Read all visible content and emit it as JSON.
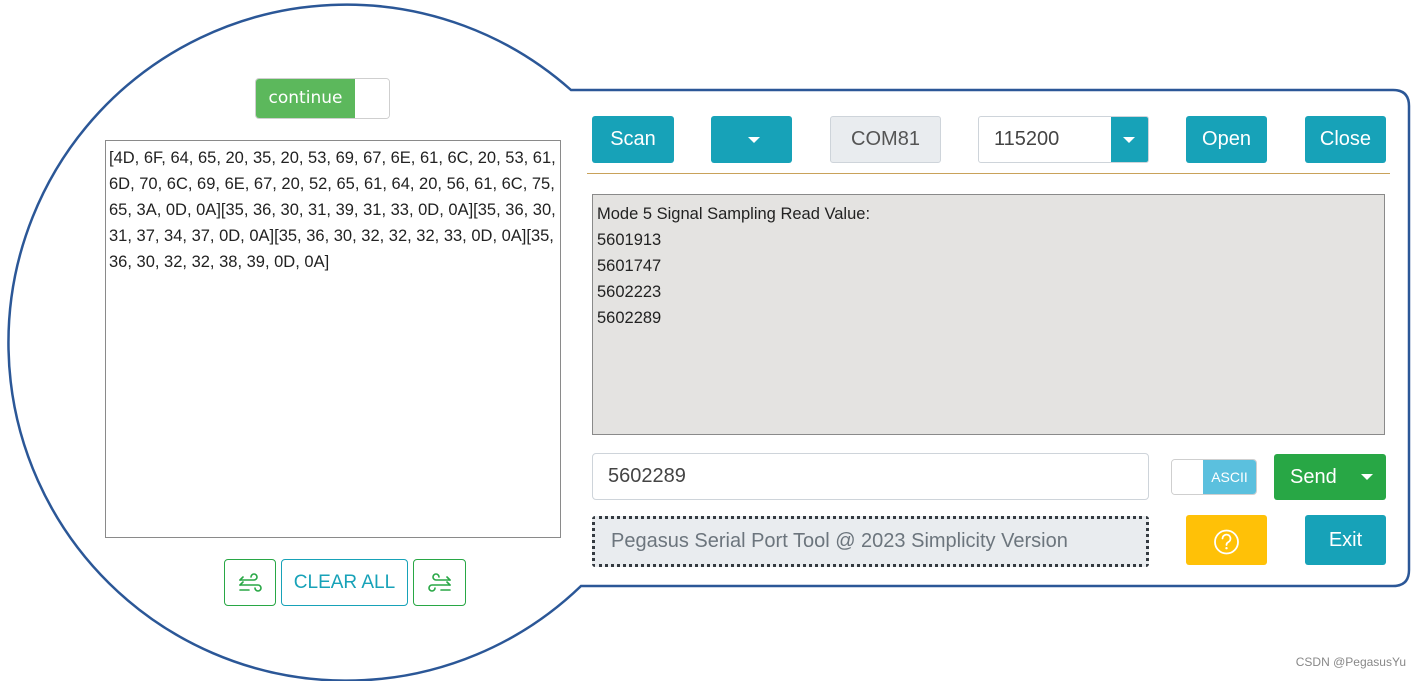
{
  "continue_toggle": {
    "label": "continue"
  },
  "hex_log": {
    "text": "[4D, 6F, 64, 65, 20, 35, 20, 53, 69, 67, 6E, 61, 6C, 20, 53, 61, 6D, 70, 6C, 69, 6E, 67, 20, 52, 65, 61, 64, 20, 56, 61, 6C, 75, 65, 3A, 0D, 0A][35, 36, 30, 31, 39, 31, 33, 0D, 0A][35, 36, 30, 31, 37, 34, 37, 0D, 0A][35, 36, 30, 32, 32, 32, 33, 0D, 0A][35, 36, 30, 32, 32, 38, 39, 0D, 0A]"
  },
  "left_actions": {
    "clear_label": "CLEAR ALL"
  },
  "toolbar": {
    "scan_label": "Scan",
    "port_value": "COM81",
    "baud_value": "115200",
    "open_label": "Open",
    "close_label": "Close"
  },
  "output": {
    "lines": [
      "Mode 5 Signal Sampling Read Value:",
      "5601913",
      "5601747",
      "5602223",
      "5602289"
    ]
  },
  "send_area": {
    "input_value": "5602289",
    "ascii_label": "ASCII",
    "send_label": "Send"
  },
  "footer": {
    "version_text": "Pegasus Serial Port Tool @ 2023 Simplicity Version",
    "exit_label": "Exit"
  },
  "watermark": "CSDN @PegasusYu",
  "colors": {
    "outline": "#2b5797",
    "teal": "#17a2b8",
    "green": "#28a745",
    "toggle_green": "#5cb85c",
    "ascii_blue": "#5bc0de",
    "help_yellow": "#ffc107",
    "output_bg": "#e4e3e1"
  }
}
